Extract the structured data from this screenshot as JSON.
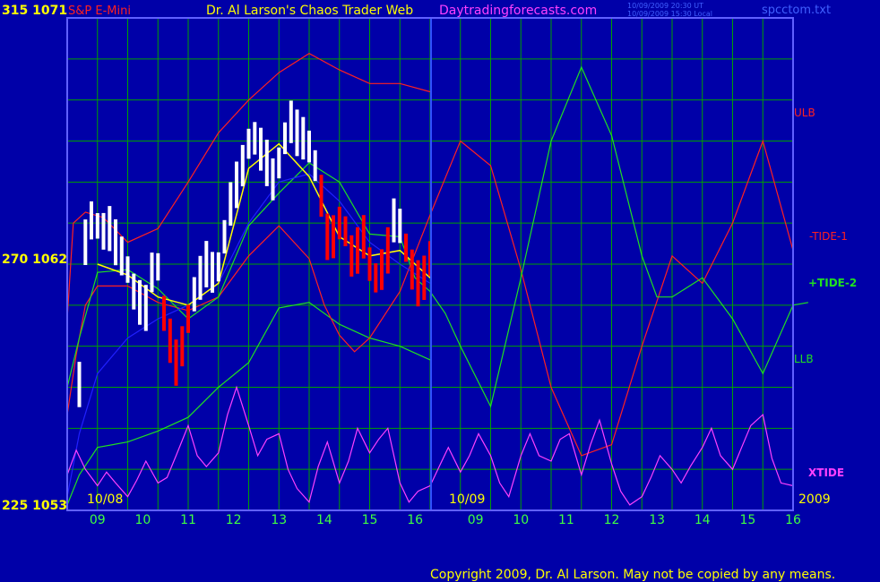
{
  "header": {
    "left_label": "315  1071",
    "symbol": "S&P E-Mini",
    "title": "Dr. Al Larson's Chaos Trader Web",
    "site": "Daytradingforecasts.com",
    "stamp_line1": "10/09/2009 20:30 UT",
    "stamp_line2": "10/09/2009 15:30 Local",
    "filename": "spcctom.txt"
  },
  "left_axis": {
    "mid": "270  1062",
    "bottom": "225  1053"
  },
  "date_labels": {
    "start": "10/08",
    "mid": "10/09",
    "year": "2009"
  },
  "legend": {
    "ulb": "ULB",
    "tide1": "-TIDE-1",
    "tide2": "+TIDE-2",
    "llb": "LLB",
    "xtide": "XTIDE"
  },
  "footer": {
    "copyright": "Copyright 2009, Dr. Al Larson. May not be copied by any means."
  },
  "colors": {
    "background": "#0000a8",
    "grid": "#00a000",
    "border": "#6060ff",
    "price_up": "#ffffff",
    "price_down": "#ff0000",
    "ulb_llb_red": "#ff2020",
    "tide_green": "#20e020",
    "blue_curve": "#2020ff",
    "xtide_magenta": "#ff40ff",
    "yellow_avg": "#ffff00",
    "yellow_text": "#ffff00",
    "hour_green": "#40ff40"
  },
  "chart_data": {
    "type": "line",
    "title": "S&P E-Mini",
    "x_ticks": [
      "09",
      "10",
      "11",
      "12",
      "13",
      "14",
      "15",
      "16",
      "09",
      "10",
      "11",
      "12",
      "13",
      "14",
      "15",
      "16"
    ],
    "y_left_price": {
      "top": 1071,
      "mid": 1062,
      "bottom": 1053
    },
    "y_left_degree": {
      "top": 315,
      "mid": 270,
      "bottom": 225
    },
    "grid": true,
    "price_bars": [
      {
        "x": 0.4,
        "y": 1057.6,
        "d": 0
      },
      {
        "x": 0.6,
        "y": 1062.8,
        "d": 0
      },
      {
        "x": 0.8,
        "y": 1063.6,
        "d": 0
      },
      {
        "x": 1.0,
        "y": 1063.4,
        "d": 0
      },
      {
        "x": 1.2,
        "y": 1063.2,
        "d": 0
      },
      {
        "x": 1.4,
        "y": 1063.3,
        "d": 0
      },
      {
        "x": 1.6,
        "y": 1062.8,
        "d": 0
      },
      {
        "x": 1.8,
        "y": 1062.3,
        "d": 0
      },
      {
        "x": 2.0,
        "y": 1061.8,
        "d": 0
      },
      {
        "x": 2.2,
        "y": 1061.0,
        "d": 0
      },
      {
        "x": 2.4,
        "y": 1060.6,
        "d": 0
      },
      {
        "x": 2.6,
        "y": 1060.4,
        "d": 0
      },
      {
        "x": 2.8,
        "y": 1061.7,
        "d": 0
      },
      {
        "x": 3.0,
        "y": 1061.9,
        "d": 0
      },
      {
        "x": 3.2,
        "y": 1060.2,
        "d": 1
      },
      {
        "x": 3.4,
        "y": 1059.2,
        "d": 1
      },
      {
        "x": 3.6,
        "y": 1058.4,
        "d": 1
      },
      {
        "x": 3.8,
        "y": 1059.0,
        "d": 1
      },
      {
        "x": 4.0,
        "y": 1060.0,
        "d": 1
      },
      {
        "x": 4.2,
        "y": 1060.9,
        "d": 0
      },
      {
        "x": 4.4,
        "y": 1061.5,
        "d": 0
      },
      {
        "x": 4.6,
        "y": 1062.0,
        "d": 0
      },
      {
        "x": 4.8,
        "y": 1061.7,
        "d": 0
      },
      {
        "x": 5.0,
        "y": 1061.9,
        "d": 0
      },
      {
        "x": 5.2,
        "y": 1063.0,
        "d": 0
      },
      {
        "x": 5.4,
        "y": 1064.2,
        "d": 0
      },
      {
        "x": 5.6,
        "y": 1064.9,
        "d": 0
      },
      {
        "x": 5.8,
        "y": 1065.6,
        "d": 0
      },
      {
        "x": 6.0,
        "y": 1066.4,
        "d": 0
      },
      {
        "x": 6.2,
        "y": 1066.6,
        "d": 0
      },
      {
        "x": 6.4,
        "y": 1066.2,
        "d": 0
      },
      {
        "x": 6.6,
        "y": 1065.7,
        "d": 0
      },
      {
        "x": 6.8,
        "y": 1065.1,
        "d": 0
      },
      {
        "x": 7.0,
        "y": 1065.7,
        "d": 0
      },
      {
        "x": 7.2,
        "y": 1066.6,
        "d": 0
      },
      {
        "x": 7.4,
        "y": 1067.2,
        "d": 0
      },
      {
        "x": 7.6,
        "y": 1066.8,
        "d": 0
      },
      {
        "x": 7.8,
        "y": 1066.6,
        "d": 0
      },
      {
        "x": 8.0,
        "y": 1066.3,
        "d": 0
      },
      {
        "x": 8.2,
        "y": 1065.6,
        "d": 0
      },
      {
        "x": 8.4,
        "y": 1064.5,
        "d": 1
      },
      {
        "x": 8.6,
        "y": 1063.0,
        "d": 1
      },
      {
        "x": 8.8,
        "y": 1063.0,
        "d": 1
      },
      {
        "x": 9.0,
        "y": 1063.5,
        "d": 1
      },
      {
        "x": 9.2,
        "y": 1063.2,
        "d": 1
      },
      {
        "x": 9.4,
        "y": 1062.3,
        "d": 1
      },
      {
        "x": 9.6,
        "y": 1062.5,
        "d": 1
      },
      {
        "x": 9.8,
        "y": 1063.0,
        "d": 1
      },
      {
        "x": 10.0,
        "y": 1062.0,
        "d": 1
      },
      {
        "x": 10.2,
        "y": 1061.5,
        "d": 1
      },
      {
        "x": 10.4,
        "y": 1061.8,
        "d": 1
      },
      {
        "x": 10.6,
        "y": 1062.5,
        "d": 1
      },
      {
        "x": 10.8,
        "y": 1063.6,
        "d": 0
      },
      {
        "x": 11.0,
        "y": 1063.4,
        "d": 0
      },
      {
        "x": 11.2,
        "y": 1062.6,
        "d": 1
      },
      {
        "x": 11.4,
        "y": 1061.8,
        "d": 1
      },
      {
        "x": 11.6,
        "y": 1061.3,
        "d": 1
      },
      {
        "x": 11.8,
        "y": 1061.5,
        "d": 1
      },
      {
        "x": 12.0,
        "y": 1062.2,
        "d": 1
      }
    ],
    "series": [
      {
        "name": "ULB",
        "color": "#ff2020",
        "x": [
          0,
          0.2,
          0.6,
          1.2,
          2,
          3,
          4,
          5,
          6,
          7,
          8,
          9,
          10,
          11,
          12
        ],
        "y": [
          1060.0,
          1063.5,
          1063.9,
          1063.7,
          1062.8,
          1063.3,
          1065.0,
          1066.8,
          1068.0,
          1069.0,
          1069.7,
          1069.1,
          1068.6,
          1068.6,
          1068.3
        ]
      },
      {
        "name": "LLB",
        "color": "#20e020",
        "x": [
          0,
          0.4,
          1,
          2,
          3,
          4,
          5,
          6,
          7,
          8,
          9,
          10,
          11,
          12
        ],
        "y": [
          1053.2,
          1054.3,
          1055.3,
          1055.5,
          1055.9,
          1056.4,
          1057.5,
          1058.4,
          1060.4,
          1060.6,
          1059.8,
          1059.3,
          1059.0,
          1058.5
        ]
      },
      {
        "name": "-TIDE-1",
        "color": "#ff2020",
        "x": [
          0,
          0.3,
          0.6,
          1,
          2,
          3,
          4,
          5,
          6,
          7,
          8,
          8.5,
          9,
          9.5,
          10,
          11,
          12,
          13,
          14,
          15,
          16,
          17,
          18,
          19,
          20,
          21,
          22,
          23,
          24
        ],
        "y": [
          1056.5,
          1058.7,
          1060.5,
          1061.2,
          1061.2,
          1060.6,
          1060.3,
          1060.8,
          1062.3,
          1063.4,
          1062.2,
          1060.5,
          1059.4,
          1058.8,
          1059.3,
          1061.0,
          1063.8,
          1066.5,
          1065.6,
          1061.8,
          1057.5,
          1055.0,
          1055.4,
          1059.0,
          1062.3,
          1061.3,
          1063.5,
          1066.5,
          1062.5
        ]
      },
      {
        "name": "+TIDE-2",
        "color": "#20e020",
        "x": [
          0,
          0.4,
          1,
          2,
          3,
          4,
          5,
          6,
          7,
          8,
          9,
          10,
          11,
          11.5,
          12,
          12.5,
          13,
          14,
          15,
          16,
          17,
          18,
          19,
          19.5,
          20,
          21,
          22,
          23,
          24,
          24.5
        ],
        "y": [
          1057.5,
          1059.3,
          1061.7,
          1061.8,
          1061.1,
          1060.0,
          1060.8,
          1063.4,
          1064.6,
          1065.7,
          1065.0,
          1063.1,
          1063.0,
          1061.5,
          1061.0,
          1060.2,
          1059.0,
          1056.8,
          1061.5,
          1066.5,
          1069.2,
          1066.7,
          1062.3,
          1060.8,
          1060.8,
          1061.5,
          1060.0,
          1058.0,
          1060.5,
          1060.6
        ]
      },
      {
        "name": "blue",
        "color": "#2020ff",
        "x": [
          0,
          0.4,
          1,
          2,
          3,
          4,
          5,
          6,
          7,
          8,
          9,
          10,
          11,
          12
        ],
        "y": [
          1053.5,
          1055.8,
          1058.0,
          1059.3,
          1060.0,
          1060.5,
          1061.3,
          1063.5,
          1065.0,
          1065.3,
          1064.3,
          1062.8,
          1062.0,
          1061.3
        ]
      },
      {
        "name": "XTIDE",
        "color": "#ff40ff",
        "x": [
          0,
          0.3,
          0.6,
          1,
          1.3,
          1.6,
          2,
          2.3,
          2.6,
          3,
          3.3,
          3.6,
          4,
          4.3,
          4.6,
          5,
          5.3,
          5.6,
          6,
          6.3,
          6.6,
          7,
          7.3,
          7.6,
          8,
          8.3,
          8.6,
          9,
          9.3,
          9.6,
          10,
          10.3,
          10.6,
          11,
          11.3,
          11.6,
          12,
          12.3,
          12.6,
          13,
          13.3,
          13.6,
          14,
          14.3,
          14.6,
          15,
          15.3,
          15.6,
          16,
          16.3,
          16.6,
          17,
          17.3,
          17.6,
          18,
          18.3,
          18.6,
          19,
          19.3,
          19.6,
          20,
          20.3,
          20.6,
          21,
          21.3,
          21.6,
          22,
          22.3,
          22.6,
          23,
          23.3,
          23.6,
          24
        ],
        "y": [
          1054.3,
          1055.2,
          1054.5,
          1053.9,
          1054.4,
          1054.0,
          1053.5,
          1054.1,
          1054.8,
          1054.0,
          1054.2,
          1055.0,
          1056.1,
          1055.0,
          1054.6,
          1055.1,
          1056.5,
          1057.5,
          1056.1,
          1055.0,
          1055.6,
          1055.8,
          1054.5,
          1053.8,
          1053.3,
          1054.6,
          1055.5,
          1054.0,
          1054.8,
          1056.0,
          1055.1,
          1055.6,
          1056.0,
          1054.0,
          1053.3,
          1053.7,
          1053.9,
          1054.6,
          1055.3,
          1054.4,
          1055.0,
          1055.8,
          1055.0,
          1054.0,
          1053.5,
          1055.0,
          1055.8,
          1055.0,
          1054.8,
          1055.6,
          1055.8,
          1054.3,
          1055.4,
          1056.3,
          1054.7,
          1053.7,
          1053.2,
          1053.5,
          1054.2,
          1055.0,
          1054.5,
          1054.0,
          1054.6,
          1055.3,
          1056.0,
          1055.0,
          1054.5,
          1055.3,
          1056.1,
          1056.5,
          1054.9,
          1054.0,
          1053.9
        ]
      },
      {
        "name": "avg",
        "color": "#ffff00",
        "x": [
          1,
          2,
          3,
          4,
          5,
          6,
          7,
          8,
          9,
          10,
          11,
          12
        ],
        "y": [
          1062.0,
          1061.6,
          1060.8,
          1060.5,
          1061.3,
          1065.5,
          1066.4,
          1065.2,
          1063.0,
          1062.3,
          1062.5,
          1061.5
        ]
      }
    ]
  }
}
